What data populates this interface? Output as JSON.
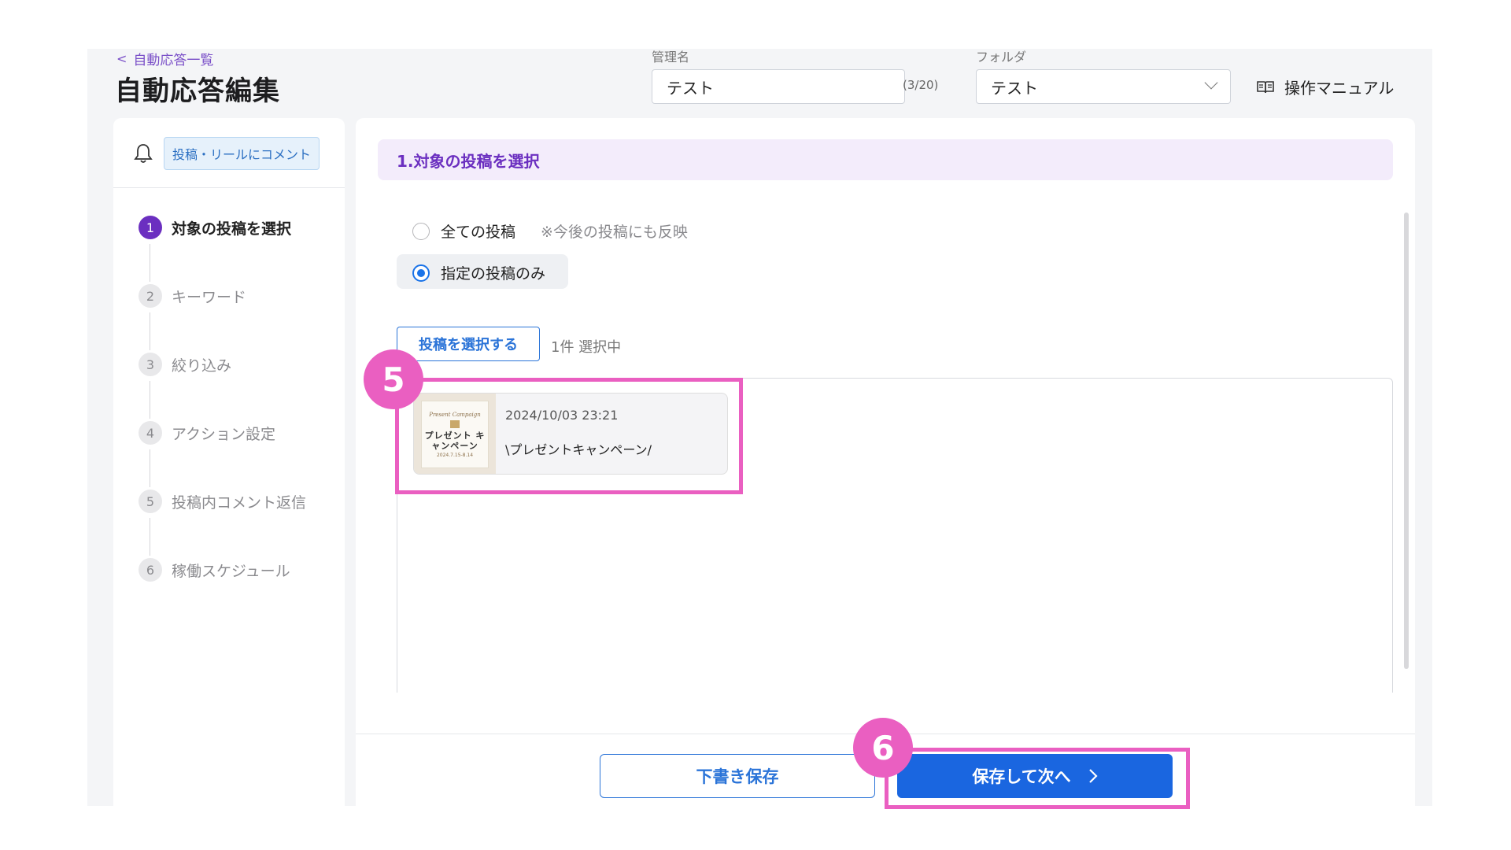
{
  "header": {
    "back_label": "自動応答一覧",
    "title": "自動応答編集",
    "name_label": "管理名",
    "name_value": "テスト",
    "name_counter": "(3/20)",
    "folder_label": "フォルダ",
    "folder_value": "テスト",
    "manual_label": "操作マニュアル"
  },
  "sidebar": {
    "trigger_tag": "投稿・リールにコメント",
    "steps": [
      {
        "num": "1",
        "label": "対象の投稿を選択",
        "active": true
      },
      {
        "num": "2",
        "label": "キーワード",
        "active": false
      },
      {
        "num": "3",
        "label": "絞り込み",
        "active": false
      },
      {
        "num": "4",
        "label": "アクション設定",
        "active": false
      },
      {
        "num": "5",
        "label": "投稿内コメント返信",
        "active": false
      },
      {
        "num": "6",
        "label": "稼働スケジュール",
        "active": false
      }
    ]
  },
  "main": {
    "section_title": "1.対象の投稿を選択",
    "option_all": "全ての投稿",
    "option_all_note": "※今後の投稿にも反映",
    "option_specific": "指定の投稿のみ",
    "selected_option": "specific",
    "select_button": "投稿を選択する",
    "selected_count": "1件 選択中",
    "posts": [
      {
        "date": "2024/10/03 23:21",
        "text": "\\プレゼントキャンペーン/",
        "thumb": {
          "line1": "Present Campaign",
          "line2": "プレゼント キャンペーン",
          "line3": "2024.7.15-8.14"
        }
      }
    ],
    "draft_button": "下書き保存",
    "next_button": "保存して次へ"
  },
  "annotations": {
    "badge_post": "5",
    "badge_next": "6",
    "color": "#ea5fc1"
  },
  "colors": {
    "accent_purple": "#6b2fc0",
    "primary_blue": "#1a66e0",
    "highlight_pink": "#ea5fc1"
  }
}
